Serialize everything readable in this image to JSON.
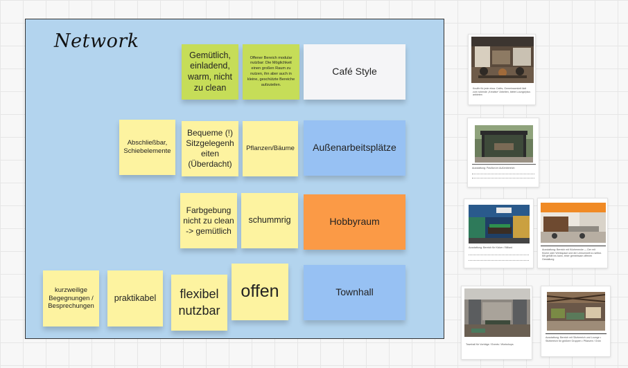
{
  "board": {
    "frame_title": "Network",
    "frame_color": "#b3d4ee"
  },
  "stickies": [
    {
      "id": "gemuetlich",
      "text": "Gemütlich, einladend, warm, nicht zu clean",
      "color": "green"
    },
    {
      "id": "offener-bereich",
      "text": "Offener Bereich modular nutzbar: Die Möglichkeit einen großen Raum zu nutzen, ihn aber auch in kleine, geschützte Bereiche aufzuteilen.",
      "color": "green"
    },
    {
      "id": "cafe-style",
      "text": "Café Style",
      "color": "white"
    },
    {
      "id": "abschliessbar",
      "text": "Abschließbar, Schiebelemente",
      "color": "yellow"
    },
    {
      "id": "bequeme",
      "text": "Bequeme (!) Sitzgelegenh eiten (Überdacht)",
      "color": "yellow"
    },
    {
      "id": "pflanzen",
      "text": "Pflanzen/Bäume",
      "color": "yellow"
    },
    {
      "id": "aussenarbeit",
      "text": "Außenarbeitsplätze",
      "color": "blue"
    },
    {
      "id": "farbgebung",
      "text": "Farbgebung nicht zu clean -> gemütlich",
      "color": "yellow"
    },
    {
      "id": "schummrig",
      "text": "schummrig",
      "color": "yellow"
    },
    {
      "id": "hobbyraum",
      "text": "Hobbyraum",
      "color": "orange"
    },
    {
      "id": "kurzweilige",
      "text": "kurzweilige Begegnungen / Besprechungen",
      "color": "yellow"
    },
    {
      "id": "praktikabel",
      "text": "praktikabel",
      "color": "yellow"
    },
    {
      "id": "flexibel",
      "text": "flexibel nutzbar",
      "color": "yellow"
    },
    {
      "id": "offen",
      "text": "offen",
      "color": "yellow"
    },
    {
      "id": "townhall",
      "text": "Townhall",
      "color": "blue"
    }
  ],
  "cards": [
    {
      "id": "card-cafe",
      "caption": "Knuffe für jede etwa: Cafés, Gemeinsamkeit lädt zum ruhende „Kreative“ Arbeiten, bietet Lounge/plus anbieten"
    },
    {
      "id": "card-pavilion",
      "caption": "Ausstattung: Pavillon im Außenbereich"
    },
    {
      "id": "card-hobby",
      "caption": "Ausstattung: Bereich für Kicker / Billiard"
    },
    {
      "id": "card-kitchen",
      "caption": "Ausstattung: Bereich mit Küchenecke — Der mit Küche oder Werkspace und die Lernumwelt zu selbst. Mit gefüllt ins kann, einer gemeinsam offenen Gestaltung"
    },
    {
      "id": "card-townhall",
      "caption": "Townhall für Vorträge / Events / Workshops"
    },
    {
      "id": "card-lounge",
      "caption": "Ausstattung: Bereich mit Sitzbereich und Lounge • Sitzbereich für größere Gruppen • Pflanzen / Grün"
    }
  ]
}
